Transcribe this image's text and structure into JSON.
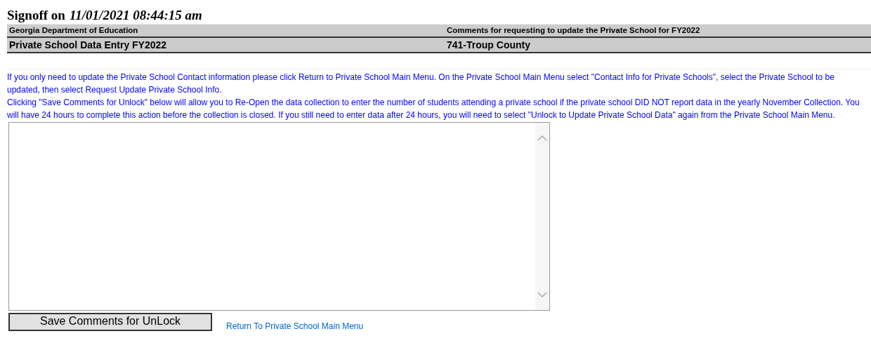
{
  "title": {
    "label": "Signoff on",
    "timestamp": "11/01/2021 08:44:15 am"
  },
  "header": {
    "row_1": [
      "Georgia Department of Education",
      "Comments for requesting to update the Private School for FY2022"
    ],
    "row_2": [
      "Private School Data Entry FY2022",
      "741-Troup County"
    ]
  },
  "instructions": [
    "If you only need to update the Private School Contact information please click Return to Private School Main Menu. On the Private School Main Menu select \"Contact Info for Private Schools\", select the Private School to be updated, then select Request Update Private School Info.",
    "Clicking \"Save Comments for Unlock\" below will allow you to Re-Open the data collection to enter the number of students attending a private school if the private school DID NOT report data in the yearly November Collection. You will have 24 hours to complete this action before the collection is closed. If you still need to enter data after 24 hours, you will need to select \"Unlock to Update Private School Data\" again from the Private School Main Menu."
  ],
  "save_button": "Save Comments for UnLock",
  "return_link": "Return To Private School Main Menu"
}
